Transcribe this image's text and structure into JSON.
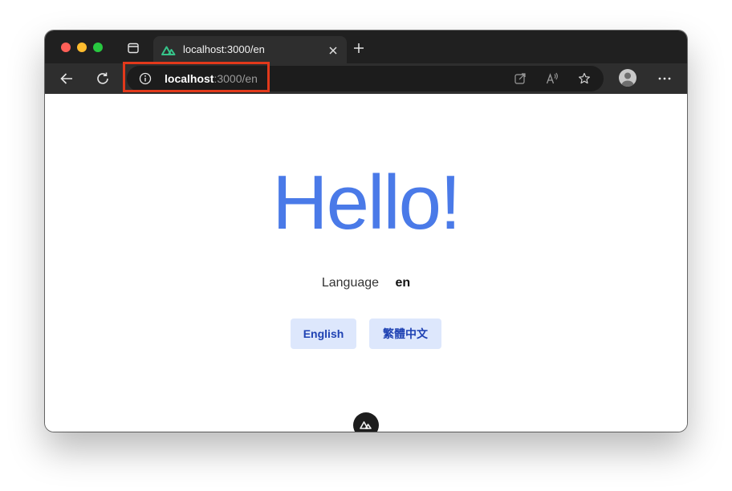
{
  "browser": {
    "tab": {
      "title": "localhost:3000/en"
    },
    "address_bar": {
      "host": "localhost",
      "path": ":3000/en"
    }
  },
  "page": {
    "heading": "Hello!",
    "language_label": "Language",
    "language_value": "en",
    "buttons": [
      {
        "label": "English"
      },
      {
        "label": "繁體中文"
      }
    ]
  },
  "icons": {
    "tab_favicon": "nuxt-logo-icon",
    "tab_close": "close-icon",
    "new_tab": "plus-icon",
    "back": "arrow-left-icon",
    "reload": "reload-icon",
    "site_info": "info-icon",
    "open_in_app": "open-in-app-icon",
    "read_aloud": "read-aloud-icon",
    "favorite": "star-icon",
    "profile": "avatar-icon",
    "more": "more-icon",
    "devtools": "nuxt-devtools-icon"
  },
  "colors": {
    "heading": "#4a7ae8",
    "button_bg": "#dde7fc",
    "button_text": "#1f42b3",
    "highlight": "#e2391b",
    "titlebar": "#202020",
    "toolbar": "#2e2e2e"
  }
}
